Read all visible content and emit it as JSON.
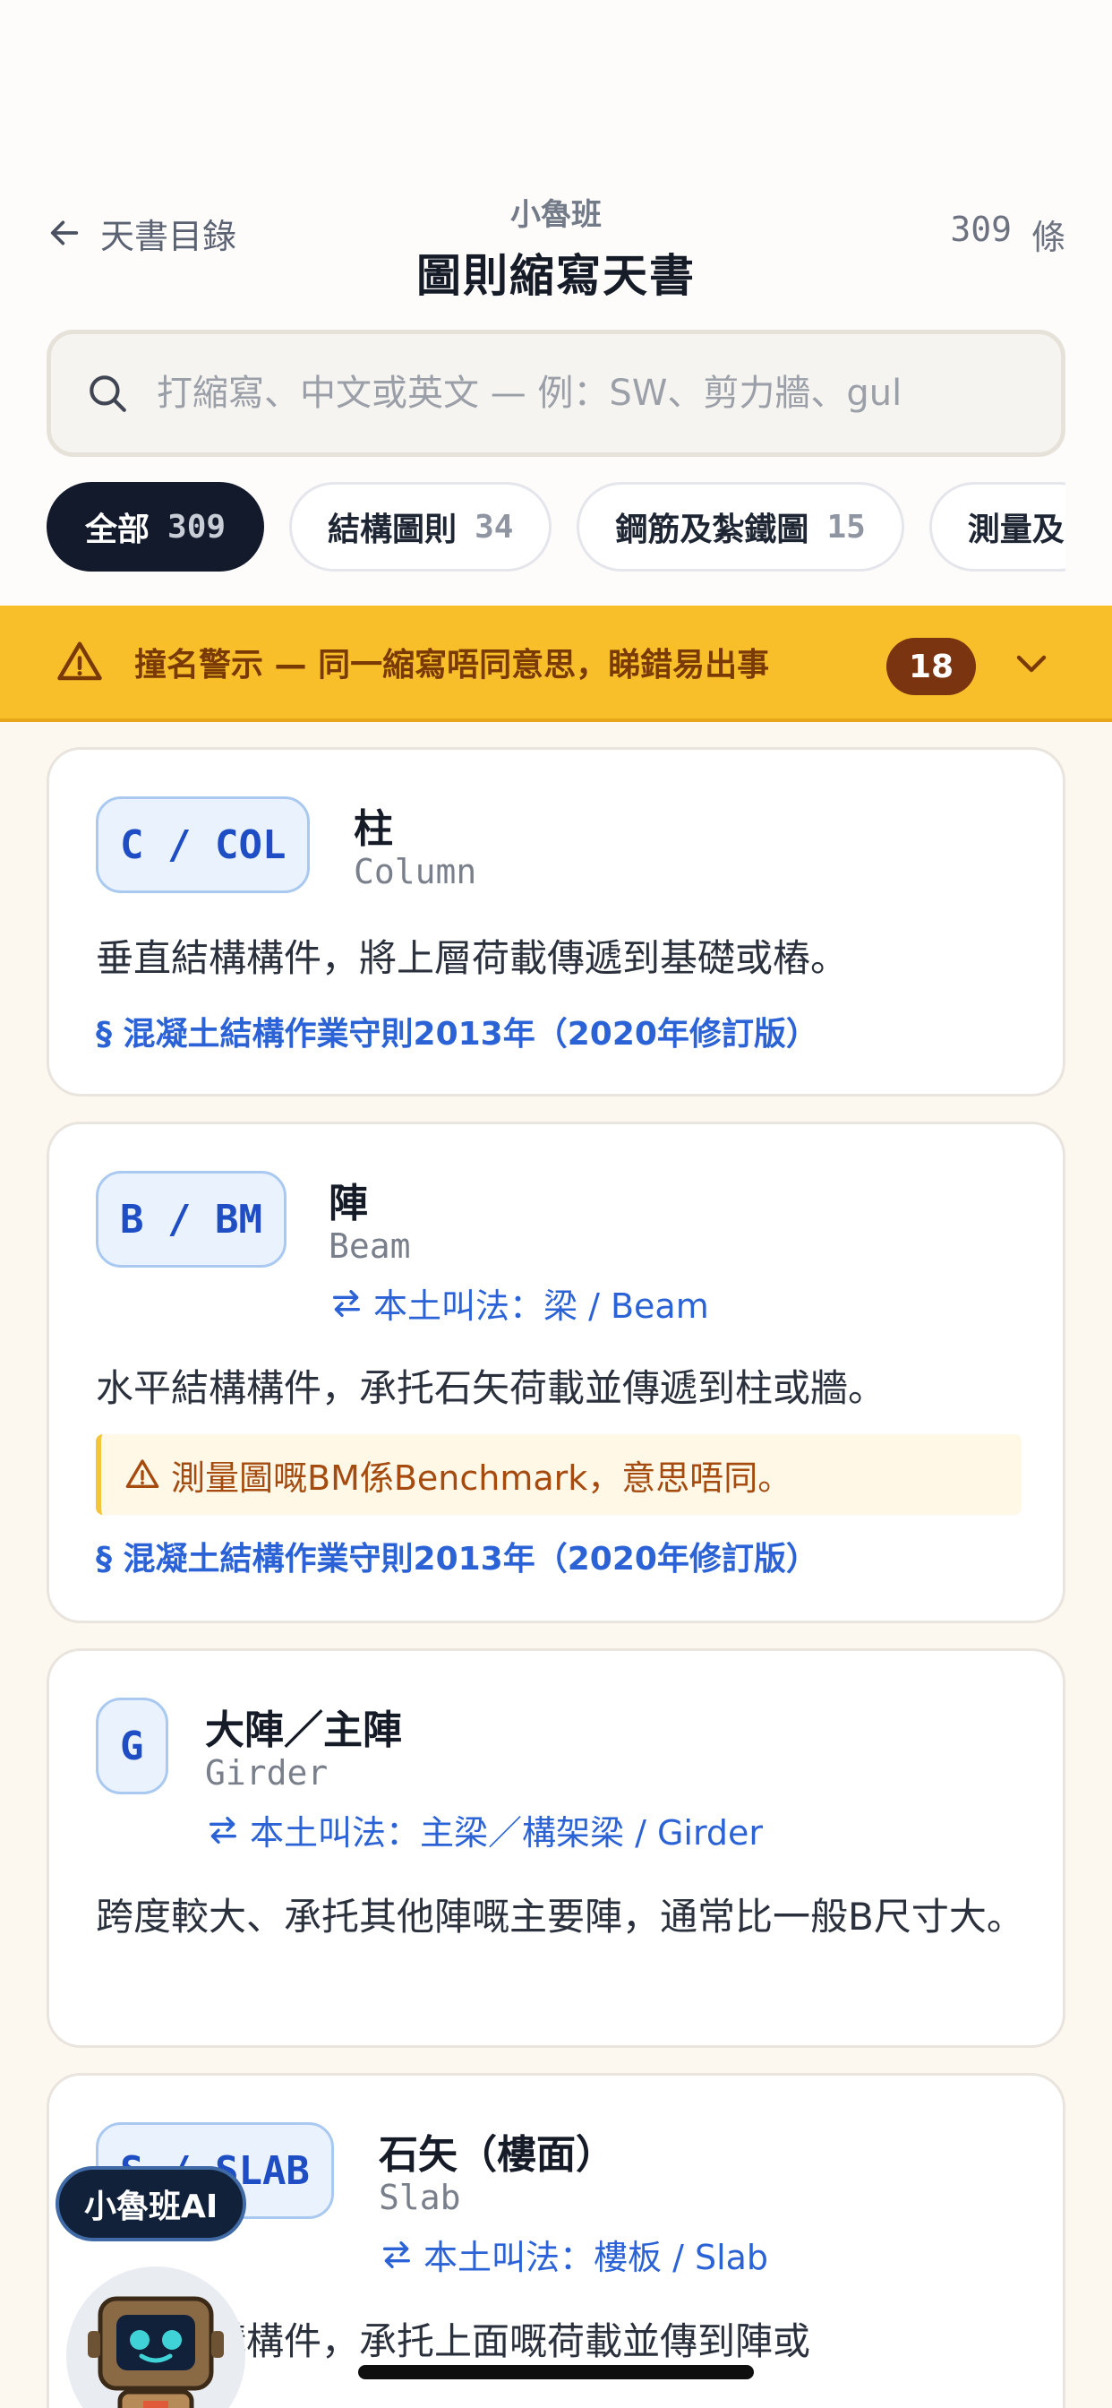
{
  "header": {
    "back_label": "天書目錄",
    "brand": "小魯班",
    "title": "圖則縮寫天書",
    "count_value": "309",
    "count_unit": "條"
  },
  "search": {
    "placeholder": "打縮寫、中文或英文 — 例：SW、剪力牆、gul",
    "value": ""
  },
  "filters": [
    {
      "label": "全部",
      "count": "309",
      "active": true
    },
    {
      "label": "結構圖則",
      "count": "34",
      "active": false
    },
    {
      "label": "鋼筋及紮鐵圖",
      "count": "15",
      "active": false
    },
    {
      "label": "測量及",
      "count": "",
      "active": false
    }
  ],
  "warning": {
    "text": "撞名警示 — 同一縮寫唔同意思，睇錯易出事",
    "count": "18"
  },
  "entries": [
    {
      "abbr": "C / COL",
      "zh": "柱",
      "en": "Column",
      "local": "",
      "description": "垂直結構構件，將上層荷載傳遞到基礎或樁。",
      "note": "",
      "reference": "§ 混凝土結構作業守則2013年（2020年修訂版）"
    },
    {
      "abbr": "B / BM",
      "zh": "陣",
      "en": "Beam",
      "local": "本土叫法：梁 / Beam",
      "description": "水平結構構件，承托石矢荷載並傳遞到柱或牆。",
      "note": "測量圖嘅BM係Benchmark，意思唔同。",
      "reference": "§ 混凝土結構作業守則2013年（2020年修訂版）"
    },
    {
      "abbr": "G",
      "zh": "大陣／主陣",
      "en": "Girder",
      "local": "本土叫法：主梁／構架梁 / Girder",
      "description": "跨度較大、承托其他陣嘅主要陣，通常比一般B尺寸大。",
      "note": "",
      "reference": ""
    },
    {
      "abbr": "S / SLAB",
      "zh": "石矢（樓面）",
      "en": "Slab",
      "local": "本土叫法：樓板 / Slab",
      "description": "板狀結構構件，承托上面嘅荷載並傳到陣或",
      "note": "",
      "reference": ""
    }
  ],
  "assistant": {
    "label": "小魯班AI"
  },
  "colors": {
    "accent_blue": "#2b63d6",
    "warning_yellow": "#f9bf2b",
    "warning_badge": "#7a3410",
    "active_chip": "#121a2b"
  }
}
